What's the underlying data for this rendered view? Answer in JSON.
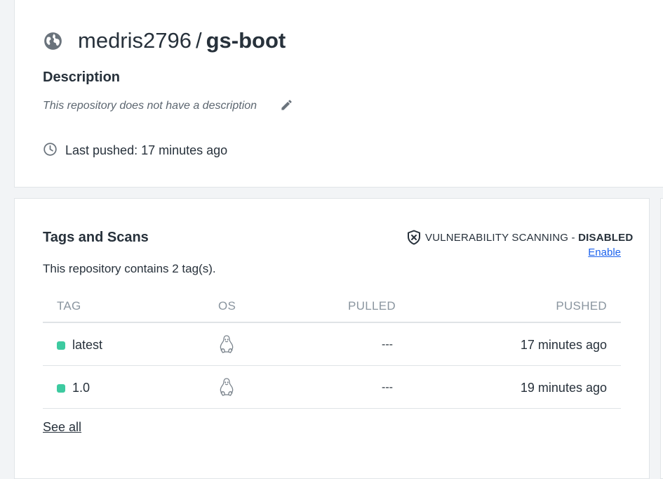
{
  "repo": {
    "owner": "medris2796",
    "separator": "/",
    "name": "gs-boot",
    "description_heading": "Description",
    "description_text": "This repository does not have a description",
    "last_pushed": "Last pushed: 17 minutes ago"
  },
  "tags_section": {
    "heading": "Tags and Scans",
    "count_text": "This repository contains 2 tag(s).",
    "vulnerability_label": "VULNERABILITY SCANNING - ",
    "vulnerability_status": "DISABLED",
    "enable_label": "Enable",
    "columns": [
      "TAG",
      "OS",
      "PULLED",
      "PUSHED"
    ],
    "rows": [
      {
        "tag": "latest",
        "os": "linux-icon",
        "pulled": "---",
        "pushed": "17 minutes ago"
      },
      {
        "tag": "1.0",
        "os": "linux-icon",
        "pulled": "---",
        "pushed": "19 minutes ago"
      }
    ],
    "see_all_label": "See all"
  },
  "colors": {
    "accent_link": "#1d63ed",
    "tag_status_dot": "#3dcaa0",
    "text_primary": "#27313b",
    "text_muted": "#8a959f"
  },
  "icons": [
    "globe-icon",
    "edit-icon",
    "clock-icon",
    "shield-icon",
    "linux-icon"
  ]
}
